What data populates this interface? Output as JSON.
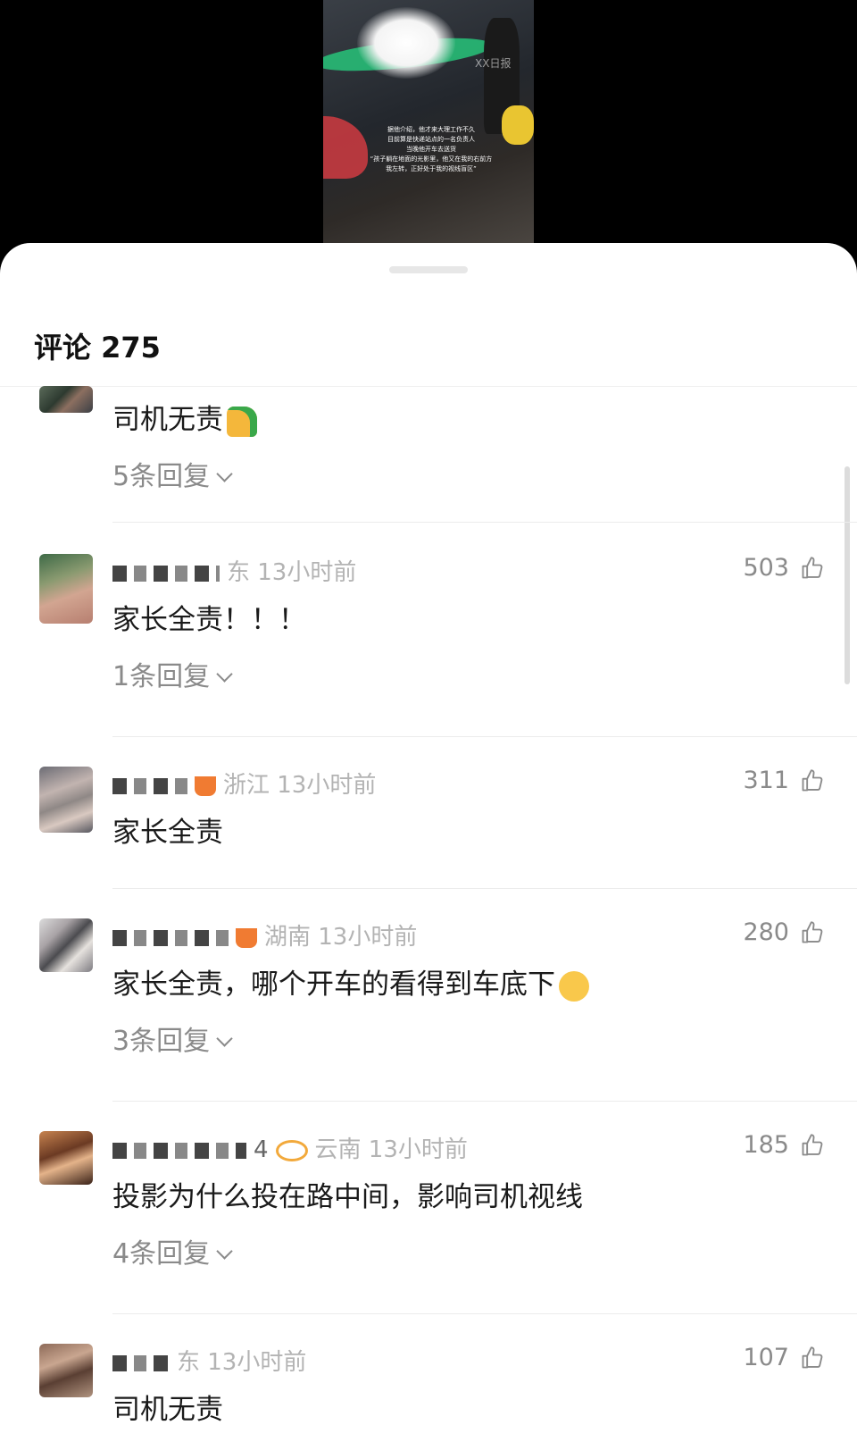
{
  "video": {
    "watermark": "XX日报",
    "caption_lines": [
      "据他介绍，他才来大理工作不久",
      "目前算是快递站点的一名负责人",
      "当晚他开车去送货",
      "“孩子躺在地面的光影里，他又在我的右前方",
      "我左转，正好处于我的视线盲区”"
    ]
  },
  "header": {
    "title": "评论 275"
  },
  "comments": [
    {
      "text": "司机无责",
      "emoji": "thumbs-up",
      "replies": "5条回复"
    },
    {
      "meta_location": "东 13小时前",
      "likes": "503",
      "text": "家长全责！！！",
      "replies": "1条回复"
    },
    {
      "meta_location": "浙江 13小时前",
      "likes": "311",
      "text": "家长全责"
    },
    {
      "meta_location": "湖南 13小时前",
      "likes": "280",
      "text": "家长全责，哪个开车的看得到车底下",
      "emoji": "laughing-crying",
      "replies": "3条回复"
    },
    {
      "meta_location": "4",
      "meta_time": "云南 13小时前",
      "likes": "185",
      "text": "投影为什么投在路中间，影响司机视线",
      "replies": "4条回复"
    },
    {
      "meta_location": "东 13小时前",
      "likes": "107",
      "text": "司机无责"
    }
  ],
  "colors": {
    "sheet_bg": "#ffffff",
    "meta_gray": "#b3b3b3",
    "text_dark": "#1a1a1a"
  }
}
